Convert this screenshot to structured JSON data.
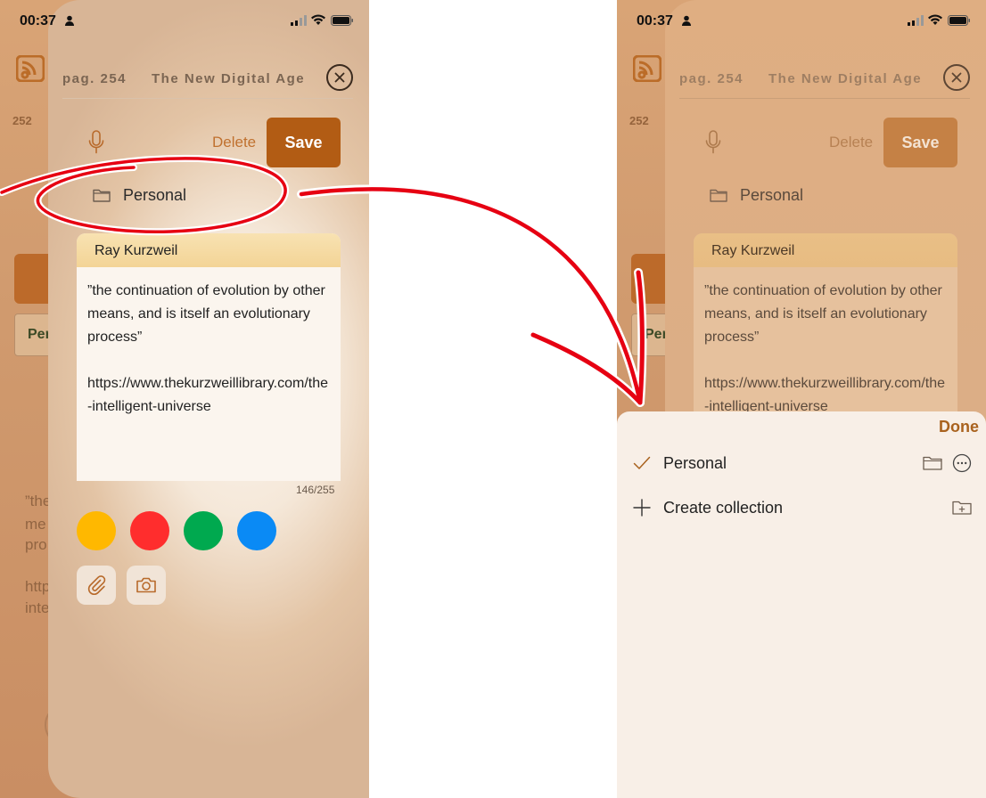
{
  "status_bar": {
    "time": "00:37"
  },
  "background_app": {
    "page_number": "252",
    "chip_label": "Per",
    "quote_fragment": [
      "”the",
      "me",
      "pro"
    ],
    "url_fragment": [
      "http",
      "inte"
    ]
  },
  "editor": {
    "header": {
      "page": "pag. 254",
      "book_title": "The New Digital Age"
    },
    "actions": {
      "delete_label": "Delete",
      "save_label": "Save"
    },
    "collection": {
      "name": "Personal"
    },
    "note": {
      "author": "Ray Kurzweil",
      "quote": "”the continuation of evolution by other means, and is itself an evolutionary process”",
      "url": "https://www.thekurzweillibrary.com/the-intelligent-universe",
      "char_count": "146/255"
    },
    "colors": [
      {
        "name": "yellow",
        "hex": "#FFB800"
      },
      {
        "name": "red",
        "hex": "#FF2D2D"
      },
      {
        "name": "green",
        "hex": "#00A94F"
      },
      {
        "name": "blue",
        "hex": "#0A8AF5"
      }
    ],
    "tools": [
      "paperclip-icon",
      "camera-icon"
    ]
  },
  "collection_picker": {
    "done_label": "Done",
    "items": [
      {
        "label": "Personal",
        "selected": true
      },
      {
        "label": "Create collection",
        "selected": false
      }
    ]
  },
  "accent_color": "#B25C14"
}
